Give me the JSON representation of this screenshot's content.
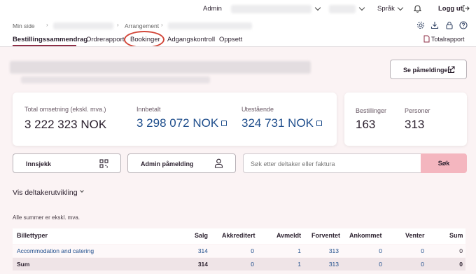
{
  "topbar": {
    "admin_label": "Admin",
    "language_label": "Språk",
    "logout_label": "Logg ut"
  },
  "breadcrumb": {
    "home": "Min side",
    "section": "Arrangement"
  },
  "tabs": [
    {
      "label": "Bestillingssammendrag"
    },
    {
      "label": "Ordrerapport"
    },
    {
      "label": "Bookinger"
    },
    {
      "label": "Adgangskontroll"
    },
    {
      "label": "Oppsett"
    }
  ],
  "total_report_label": "Totalrapport",
  "see_registration_label": "Se påmeldingen",
  "stats": {
    "revenue_label": "Total omsetning (ekskl. mva.)",
    "revenue_value": "3 222 323 NOK",
    "paid_label": "Innbetalt",
    "paid_value": "3 298 072 NOK",
    "outstanding_label": "Utestående",
    "outstanding_value": "324 731 NOK",
    "orders_label": "Bestillinger",
    "orders_value": "163",
    "persons_label": "Personer",
    "persons_value": "313"
  },
  "actions": {
    "checkin_label": "Innsjekk",
    "admin_registration_label": "Admin påmelding",
    "search_placeholder": "Søk etter deltaker eller faktura",
    "search_button": "Søk"
  },
  "participant_toggle": "Vis deltakerutvikling",
  "vat_note": "Alle summer er ekskl. mva.",
  "table": {
    "headers": [
      "Billettyper",
      "Salg",
      "Akkreditert",
      "Avmeldt",
      "Forventet",
      "Ankommet",
      "Venter",
      "Sum"
    ],
    "rows": [
      {
        "name": "Accommodation and catering",
        "salg": "314",
        "akkreditert": "0",
        "avmeldt": "1",
        "forventet": "313",
        "ankommet": "0",
        "venter": "0",
        "sum": "0"
      }
    ],
    "total": {
      "name": "Sum",
      "salg": "314",
      "akkreditert": "0",
      "avmeldt": "1",
      "forventet": "313",
      "ankommet": "0",
      "venter": "0",
      "sum": "0"
    }
  },
  "colors": {
    "accent": "#8e2e46",
    "link": "#1f4e8c",
    "search_button": "#f4b6bf",
    "page_background": "#fbf3f4",
    "highlight_circle": "#d2473a"
  }
}
